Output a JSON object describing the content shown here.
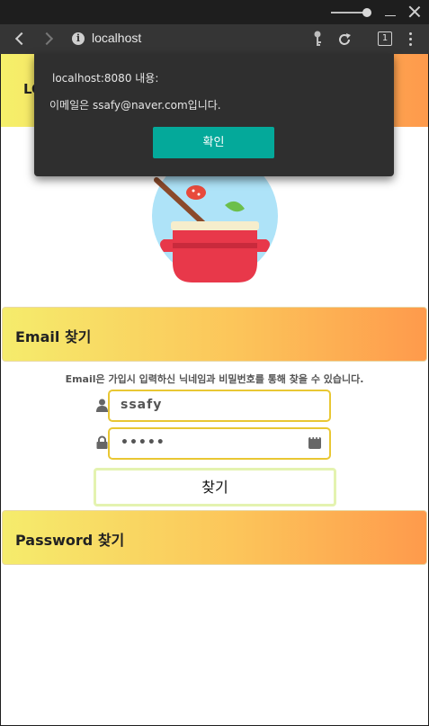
{
  "browser": {
    "url": "localhost",
    "tab_count": "1"
  },
  "page": {
    "header_text": "LO",
    "email_section_title": "Email 찾기",
    "description": "Email은 가입시 입력하신 닉네임과 비밀번호를 통해 찾을 수 있습니다.",
    "nickname_value": "ssafy",
    "password_value": "*****",
    "find_button_label": "찾기",
    "password_section_title": "Password 찾기"
  },
  "alert": {
    "origin": "localhost:8080 내용:",
    "message": "이메일은 ssafy@naver.com입니다.",
    "ok_label": "확인"
  },
  "colors": {
    "gradient_start": "#f5f06a",
    "gradient_end": "#fe9a4c",
    "field_border": "#e9c733",
    "alert_button": "#04a99a"
  }
}
